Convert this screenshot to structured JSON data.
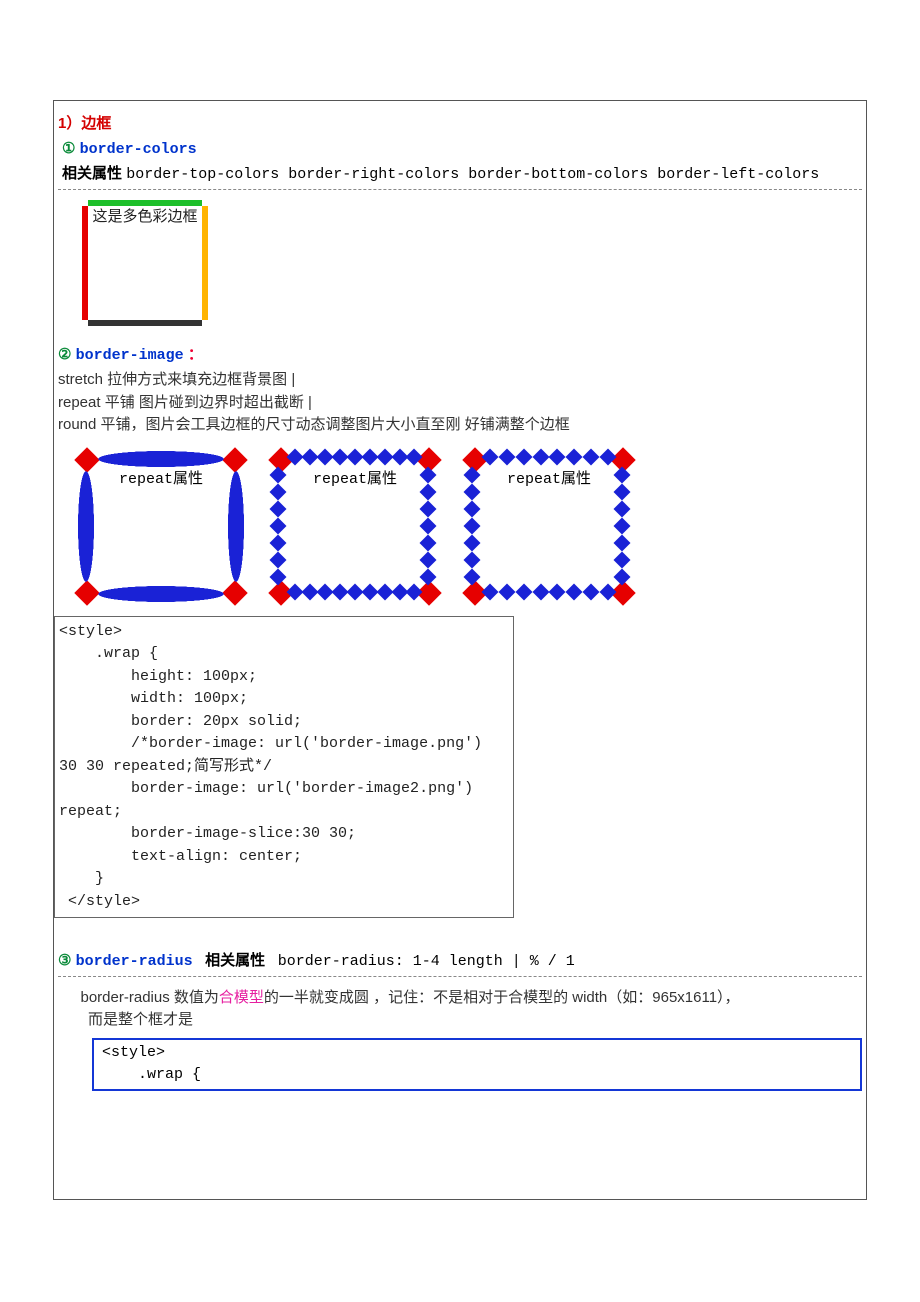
{
  "section": {
    "title": "1）边框",
    "s1": {
      "num": "①",
      "kw": "border-colors",
      "rel_label": "相关属性",
      "rel_props": "border-top-colors  border-right-colors  border-bottom-colors  border-left-colors",
      "demo_text": "这是多色彩边框"
    },
    "s2": {
      "num": "②",
      "kw": "border-image",
      "colon": "：",
      "line1": "stretch 拉伸方式来填充边框背景图 |",
      "line2": "repeat 平铺 图片碰到边界时超出截断 |",
      "line3": "round 平铺，图片会工具边框的尺寸动态调整图片大小直至刚 好铺满整个边框",
      "box_label": "repeat属性",
      "code": "<style>\n    .wrap {\n        height: 100px;\n        width: 100px;\n        border: 20px solid;\n        /*border-image: url('border-image.png') 30 30 repeated;简写形式*/\n        border-image: url('border-image2.png') repeat;\n        border-image-slice:30 30;\n        text-align: center;\n    }\n </style>"
    },
    "s3": {
      "num": "③",
      "kw": "border-radius",
      "rel_label": "相关属性",
      "rel_props": "border-radius: 1-4 length | % / 1",
      "p1a": "border-radius 数值为",
      "p1_hl": "合模型",
      "p1b": "的一半就变成圆 ，记住：不是相对于合模型的 width（如：965x1611），",
      "p2": "而是整个框才是",
      "code": "<style>\n    .wrap {"
    }
  }
}
